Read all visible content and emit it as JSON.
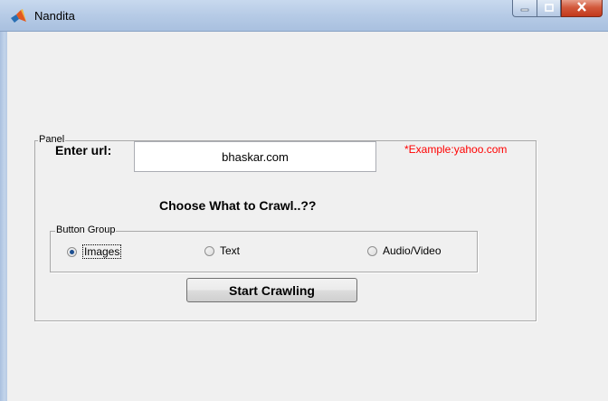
{
  "window": {
    "title": "Nandita",
    "icon": "matlab-icon",
    "controls": [
      "minimize-icon",
      "maximize-icon",
      "close-icon"
    ]
  },
  "panel": {
    "title": "Panel",
    "url_label": "Enter url:",
    "url_value": "bhaskar.com",
    "example_text": "*Example:yahoo.com",
    "choose_text": "Choose What to Crawl..??",
    "button_group": {
      "title": "Button Group",
      "options": [
        {
          "label": "Images",
          "selected": true
        },
        {
          "label": "Text",
          "selected": false
        },
        {
          "label": "Audio/Video",
          "selected": false
        }
      ]
    },
    "start_button": "Start Crawling"
  },
  "colors": {
    "example_text": "#ff0000",
    "titlebar": "#b6cbe6",
    "background": "#f0f0f0"
  }
}
